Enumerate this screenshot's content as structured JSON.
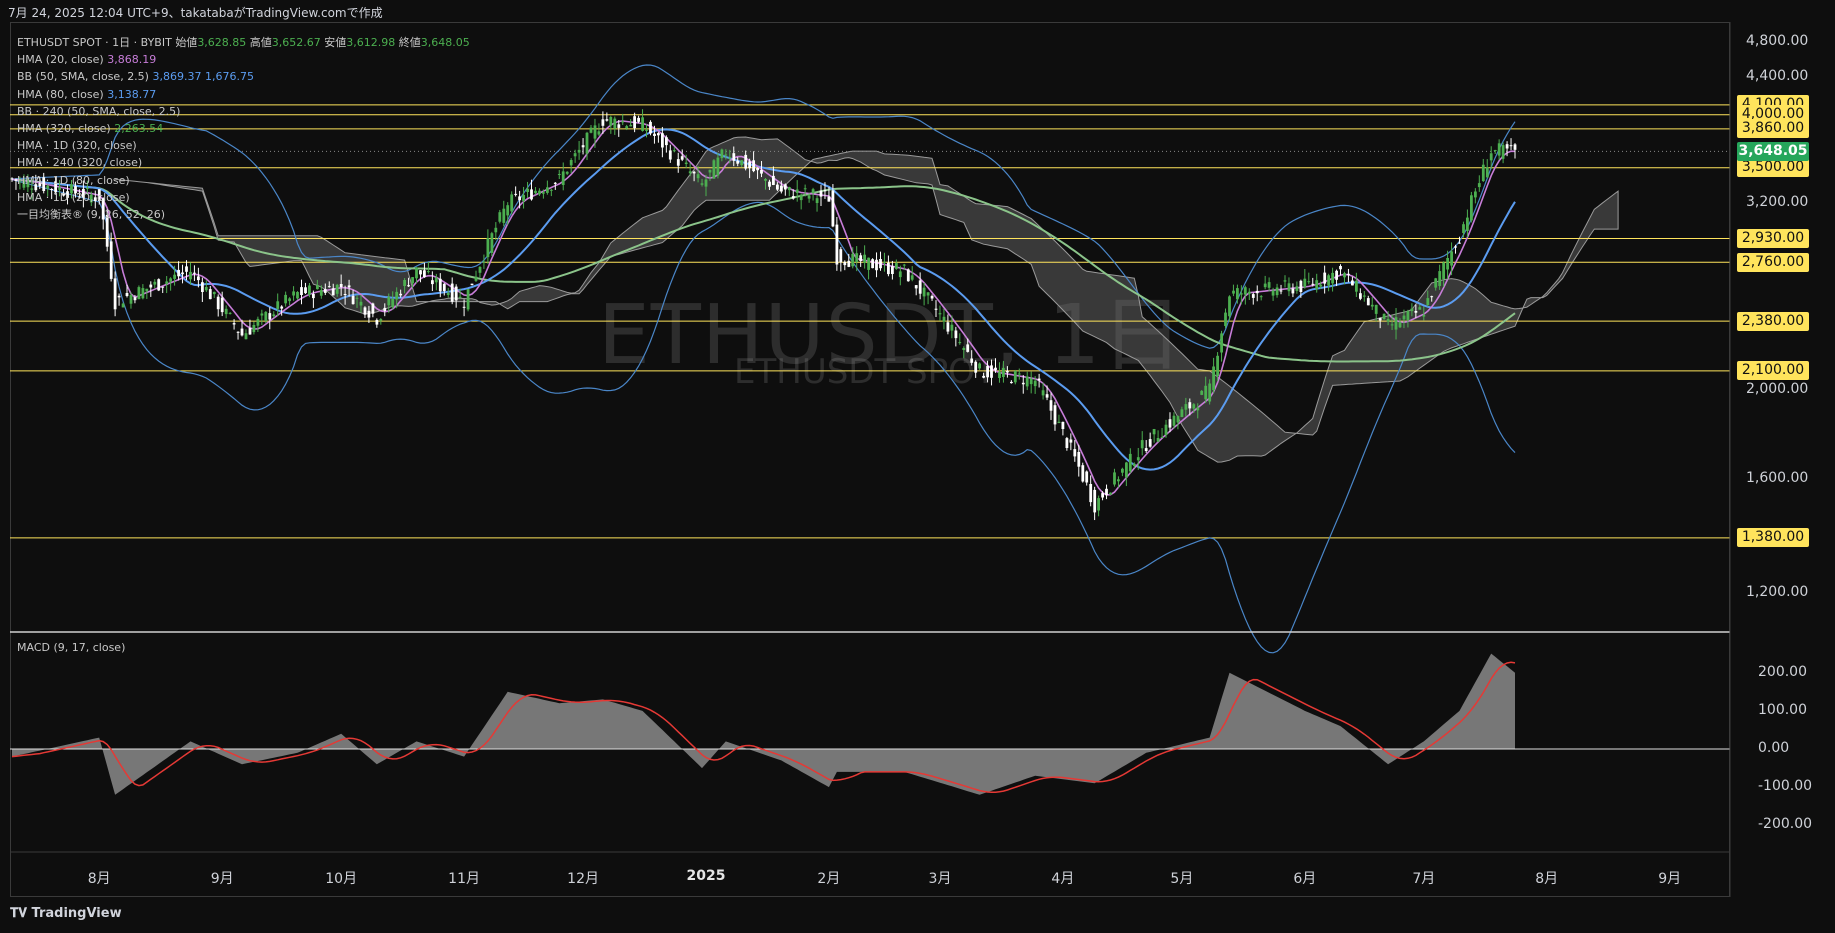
{
  "header": {
    "caption": "7月 24, 2025 12:04 UTC+9、takatabaがTradingView.comで作成"
  },
  "legend": {
    "symbol_line": "ETHUSDT SPOT · 1日 · BYBIT",
    "open_label": "始値",
    "open": "3,628.85",
    "high_label": "高値",
    "high": "3,652.67",
    "low_label": "安値",
    "low": "3,612.98",
    "close_label": "終値",
    "close": "3,648.05",
    "hma20": {
      "name": "HMA (20, close)",
      "value": "3,868.19"
    },
    "bb": {
      "name": "BB (50, SMA, close, 2.5)",
      "upper": "3,869.37",
      "lower": "1,676.75"
    },
    "hma80": {
      "name": "HMA (80, close)",
      "value": "3,138.77"
    },
    "bb240": {
      "name": "BB · 240 (50, SMA, close, 2.5)"
    },
    "hma320": {
      "name": "HMA (320, close)",
      "value": "2,263.54"
    },
    "hma1d320": {
      "name": "HMA · 1D (320, close)"
    },
    "hma240_320": {
      "name": "HMA · 240 (320, close)"
    },
    "hma1d80": {
      "name": "HMA · 1D (80, close)"
    },
    "hma1d20": {
      "name": "HMA · 1D (20, close)"
    },
    "ichimoku": {
      "name": "一目均衡表® (9, 26, 52, 26)"
    }
  },
  "macd_title": "MACD (9, 17, close)",
  "watermark": {
    "main": "ETHUSDT, 1日",
    "sub": "ETHUSDT SPOT"
  },
  "price_axis": [
    "4,800.00",
    "4,400.00",
    "3,200.00",
    "2,000.00",
    "1,600.00",
    "1,200.00"
  ],
  "level_labels": [
    "4,100.00",
    "4,000.00",
    "3,860.00",
    "3,500.00",
    "2,930.00",
    "2,760.00",
    "2,380.00",
    "2,100.00",
    "1,380.00"
  ],
  "current_price_label": "3,648.05",
  "macd_axis": [
    "200.00",
    "100.00",
    "0.00",
    "-100.00",
    "-200.00"
  ],
  "time_axis": [
    "8月",
    "9月",
    "10月",
    "11月",
    "12月",
    "2025",
    "2月",
    "3月",
    "4月",
    "5月",
    "6月",
    "7月",
    "8月",
    "9月"
  ],
  "footer": {
    "logo_text": "TradingView"
  },
  "colors": {
    "background": "#0e0e0e",
    "up": "#4caf50",
    "down": "#ffffff",
    "hma20": "#c77dd8",
    "hma80": "#5b9cf0",
    "hma320": "#8bc48a",
    "bb": "#4a86c8",
    "level": "#ffe45c",
    "cloud": "#6e6e6e",
    "macd_signal": "#e53935",
    "macd_hist": "#8a8a8a"
  },
  "chart_data": {
    "type": "line",
    "title": "ETHUSDT, 1日",
    "x": [
      "2024-07-10",
      "2024-08-01",
      "2024-08-05",
      "2024-08-24",
      "2024-09-06",
      "2024-09-20",
      "2024-10-01",
      "2024-10-10",
      "2024-10-20",
      "2024-11-01",
      "2024-11-12",
      "2024-11-25",
      "2024-12-06",
      "2024-12-16",
      "2024-12-31",
      "2025-01-06",
      "2025-01-20",
      "2025-02-01",
      "2025-02-03",
      "2025-02-20",
      "2025-03-11",
      "2025-03-25",
      "2025-04-09",
      "2025-04-22",
      "2025-05-08",
      "2025-05-13",
      "2025-06-01",
      "2025-06-10",
      "2025-06-22",
      "2025-07-01",
      "2025-07-10",
      "2025-07-18",
      "2025-07-24"
    ],
    "series": [
      {
        "name": "ETHUSDT",
        "values": [
          3400,
          3250,
          2500,
          2700,
          2300,
          2550,
          2600,
          2400,
          2700,
          2500,
          3200,
          3400,
          3950,
          3900,
          3350,
          3650,
          3300,
          3250,
          2800,
          2700,
          2100,
          2050,
          1500,
          1750,
          2000,
          2550,
          2600,
          2700,
          2350,
          2450,
          2950,
          3650,
          3648
        ]
      },
      {
        "name": "MACD",
        "values": [
          -20,
          30,
          -120,
          20,
          -40,
          -10,
          40,
          -40,
          20,
          -20,
          150,
          120,
          130,
          100,
          -50,
          20,
          -30,
          -100,
          -60,
          -60,
          -120,
          -70,
          -90,
          -10,
          30,
          200,
          100,
          60,
          -40,
          20,
          100,
          250,
          200
        ]
      }
    ],
    "horizontal_levels": [
      4100,
      4000,
      3860,
      3500,
      2930,
      2760,
      2380,
      2100,
      1380
    ],
    "last_price": 3648.05,
    "ylim": [
      1100,
      5000
    ],
    "macd_ylim": [
      -270,
      270
    ],
    "y_scale": "log",
    "grid": false
  }
}
